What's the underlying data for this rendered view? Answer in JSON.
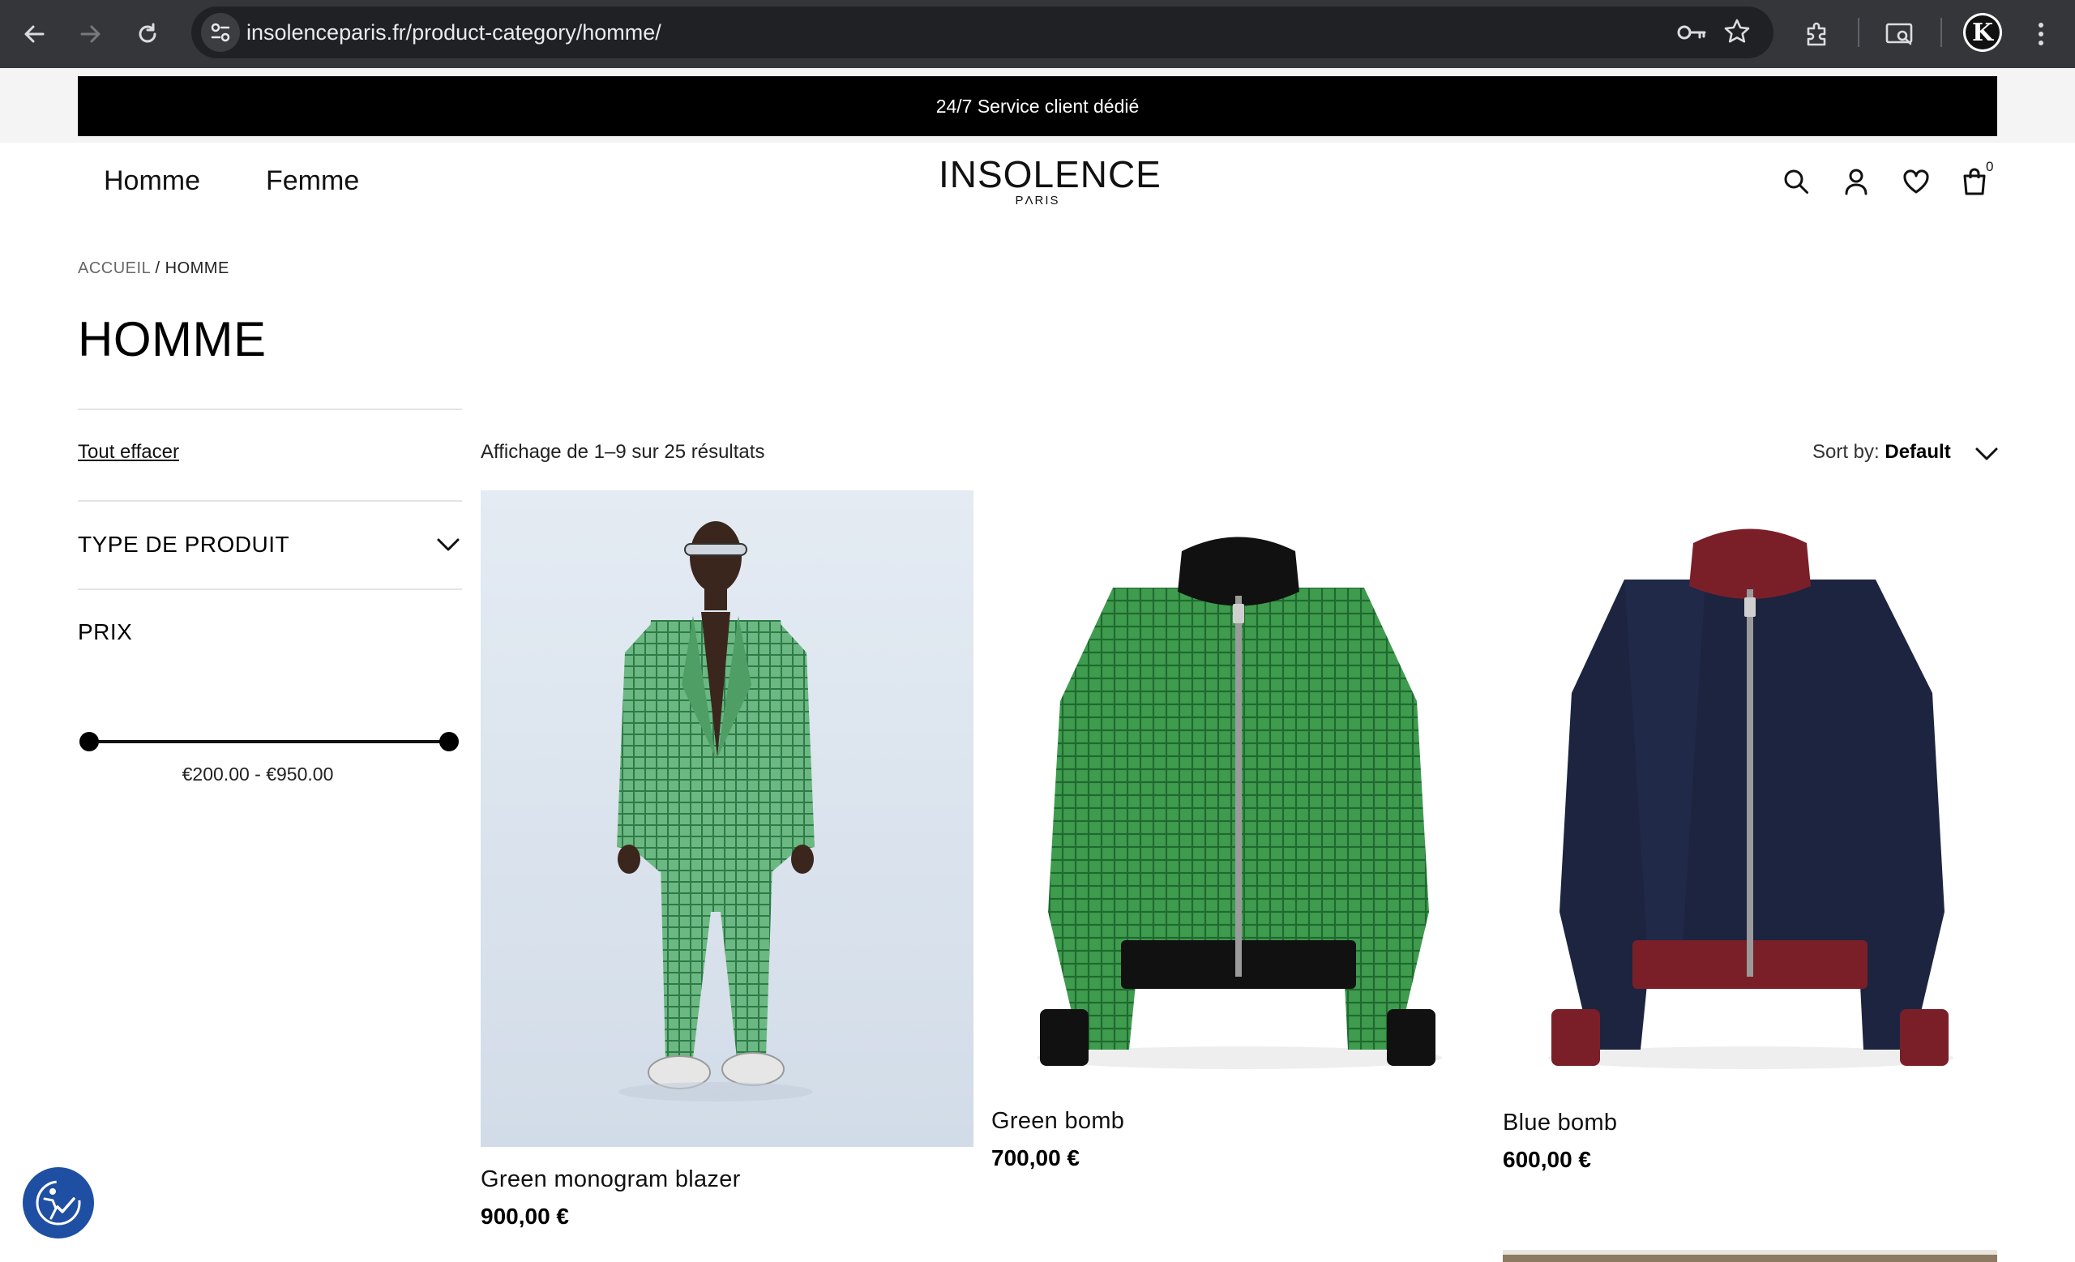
{
  "browser": {
    "url": "insolenceparis.fr/product-category/homme/",
    "profile_initial": "K"
  },
  "announcement": "24/7 Service client dédié",
  "nav": {
    "items": [
      "Homme",
      "Femme"
    ]
  },
  "logo": {
    "wordmark": "INSOLENCE",
    "sub": "PΛRIS"
  },
  "header_icons": [
    "search-icon",
    "account-icon",
    "wishlist-heart-icon",
    "cart-bag-icon"
  ],
  "cart_count": "0",
  "breadcrumb": {
    "root": "ACCUEIL",
    "separator": " / ",
    "current": "HOMME"
  },
  "page_title": "HOMME",
  "filters": {
    "clear_all": "Tout effacer",
    "product_type_label": "TYPE DE PRODUIT",
    "price_label": "PRIX",
    "price_range_text": "€200.00 - €950.00",
    "price_min": 200,
    "price_max": 950
  },
  "results": {
    "count_text": "Affichage de 1–9 sur 25 résultats",
    "sort_label": "Sort by:",
    "sort_value": "Default"
  },
  "products": [
    {
      "name": "Green monogram blazer",
      "price": "900,00 €",
      "image": "man-in-green-monogram-suit"
    },
    {
      "name": "Green bomb",
      "price": "700,00 €",
      "image": "green-monogram-bomber-jacket"
    },
    {
      "name": "Blue bomb",
      "price": "600,00 €",
      "image": "navy-bomber-jacket-burgundy-trim"
    }
  ],
  "colors": {
    "announcement_bg": "#000000",
    "accessibility_button": "#1e4fa3",
    "green_jacket": "#3e9a4d",
    "navy_jacket": "#1c2440",
    "burgundy_trim": "#7a1f28"
  }
}
